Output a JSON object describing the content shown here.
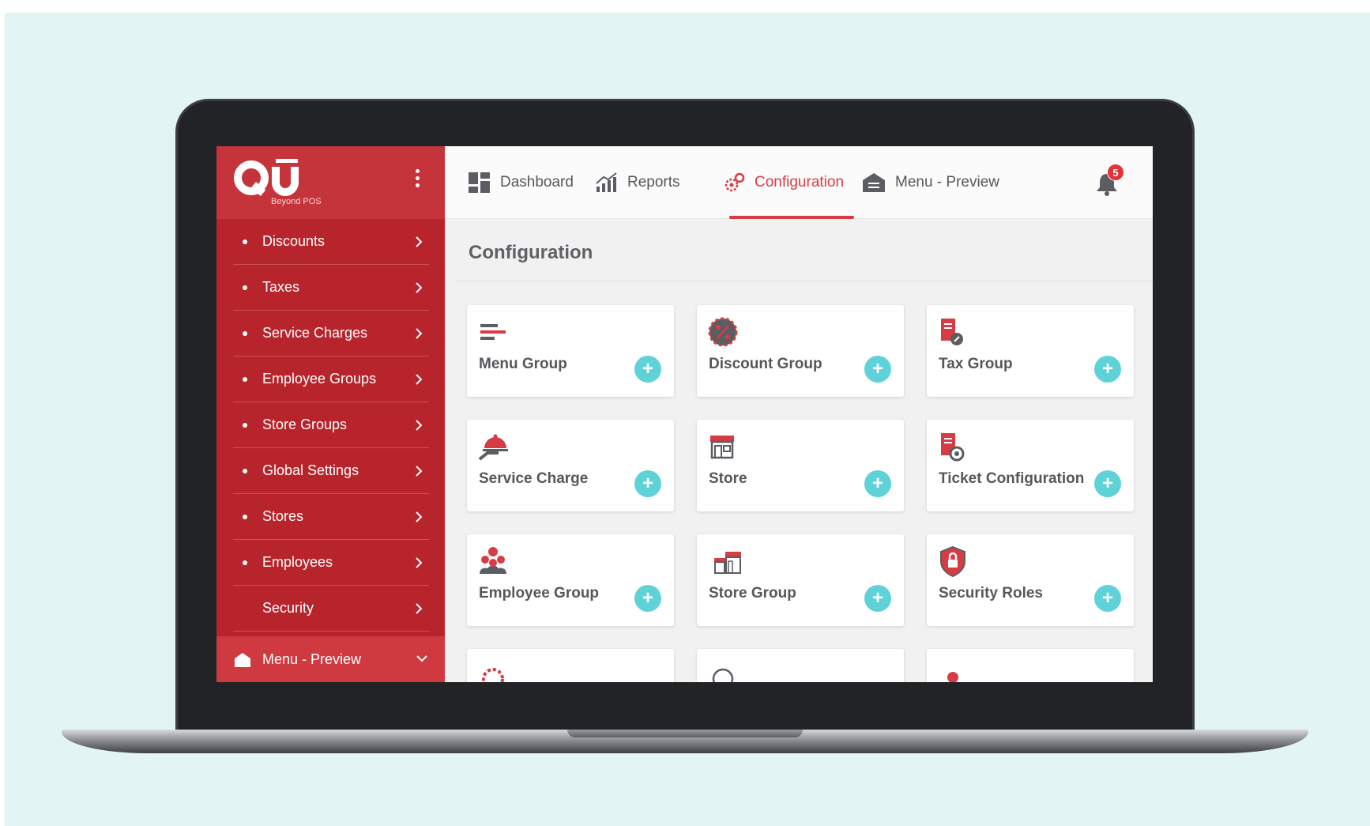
{
  "app": {
    "logo_text": "QU",
    "logo_tagline": "Beyond POS",
    "brand_color": "#b8242b",
    "accent_color": "#d73c45",
    "action_color": "#5fd2d8"
  },
  "sidebar": {
    "items": [
      {
        "label": "Discounts",
        "bullet": true
      },
      {
        "label": "Taxes",
        "bullet": true
      },
      {
        "label": "Service Charges",
        "bullet": true
      },
      {
        "label": "Employee Groups",
        "bullet": true
      },
      {
        "label": "Store Groups",
        "bullet": true
      },
      {
        "label": "Global Settings",
        "bullet": true
      },
      {
        "label": "Stores",
        "bullet": true
      },
      {
        "label": "Employees",
        "bullet": true
      },
      {
        "label": "Security",
        "bullet": false
      }
    ],
    "footer": {
      "label": "Menu - Preview",
      "icon": "home-icon"
    }
  },
  "topbar": {
    "tabs": [
      {
        "label": "Dashboard",
        "icon": "dashboard-icon",
        "active": false
      },
      {
        "label": "Reports",
        "icon": "reports-icon",
        "active": false
      },
      {
        "label": "Configuration",
        "icon": "gears-icon",
        "active": true
      },
      {
        "label": "Menu - Preview",
        "icon": "home-icon",
        "active": false
      }
    ],
    "notifications": {
      "count": "5",
      "icon": "bell-icon"
    }
  },
  "main": {
    "title": "Configuration",
    "cards": [
      {
        "label": "Menu Group",
        "icon": "menu-lines-icon"
      },
      {
        "label": "Discount Group",
        "icon": "discount-badge-icon"
      },
      {
        "label": "Tax Group",
        "icon": "tax-document-icon"
      },
      {
        "label": "Service Charge",
        "icon": "cloche-icon"
      },
      {
        "label": "Store",
        "icon": "storefront-icon"
      },
      {
        "label": "Ticket Configuration",
        "icon": "ticket-settings-icon"
      },
      {
        "label": "Employee Group",
        "icon": "people-group-icon"
      },
      {
        "label": "Store Group",
        "icon": "stores-icon"
      },
      {
        "label": "Security Roles",
        "icon": "shield-lock-icon"
      }
    ],
    "add_label": "+"
  }
}
